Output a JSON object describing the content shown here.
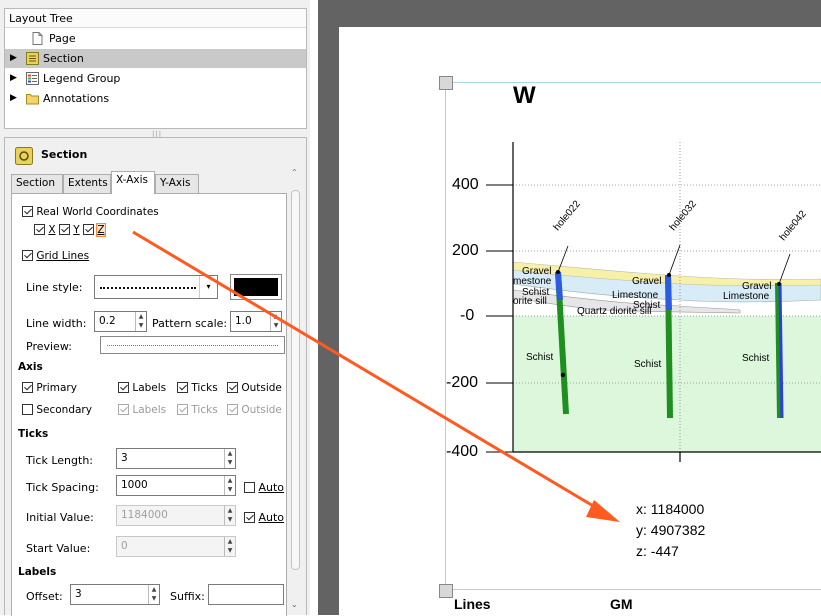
{
  "tree": {
    "title": "Layout Tree",
    "items": [
      {
        "label": "Page"
      },
      {
        "label": "Section"
      },
      {
        "label": "Legend Group"
      },
      {
        "label": "Annotations"
      }
    ]
  },
  "props": {
    "title": "Section",
    "tabs": [
      "Section",
      "Extents",
      "X-Axis",
      "Y-Axis"
    ],
    "real_world": "Real World Coordinates",
    "xyz": [
      "X",
      "Y",
      "Z"
    ],
    "grid_lines": "Grid Lines",
    "line_style_label": "Line style:",
    "line_width_label": "Line width:",
    "line_width_value": "0.2",
    "pattern_scale_label": "Pattern scale:",
    "pattern_scale_value": "1.0",
    "preview_label": "Preview:",
    "axis_heading": "Axis",
    "primary": "Primary",
    "secondary": "Secondary",
    "labels": "Labels",
    "ticks": "Ticks",
    "outside": "Outside",
    "ticks_heading": "Ticks",
    "tick_length_label": "Tick Length:",
    "tick_length_value": "3",
    "tick_spacing_label": "Tick Spacing:",
    "tick_spacing_value": "1000",
    "auto": "Auto",
    "initial_value_label": "Initial Value:",
    "initial_value_value": "1184000",
    "start_value_label": "Start Value:",
    "start_value_value": "0",
    "labels_heading": "Labels",
    "offset_label": "Offset:",
    "offset_value": "3",
    "suffix_label": "Suffix:",
    "suffix_value": ""
  },
  "section_view": {
    "direction": "W",
    "y_ticks": [
      "400",
      "200",
      "-0",
      "-200",
      "-400"
    ],
    "holes": [
      "hole022",
      "hole032",
      "hole042"
    ],
    "unit_labels": [
      "Gravel",
      "mestone",
      "Schist",
      "orite sill",
      "Gravel",
      "Limestone",
      "Schist",
      "Quartz  diorite sill",
      "Gravel",
      "Limestone",
      "Schist",
      "Schist",
      "Schist"
    ],
    "coords": {
      "x": "x: 1184000",
      "y": "y: 4907382",
      "z": "z: -447"
    },
    "footer": [
      "Lines",
      "GM"
    ]
  },
  "colors": {
    "accent_arrow": "#ff5a1f",
    "selection": "#c9c9c9",
    "schist_fill": "#ddf7dd",
    "limestone": "#d7ecf7",
    "gravel": "#f7f0a8"
  }
}
